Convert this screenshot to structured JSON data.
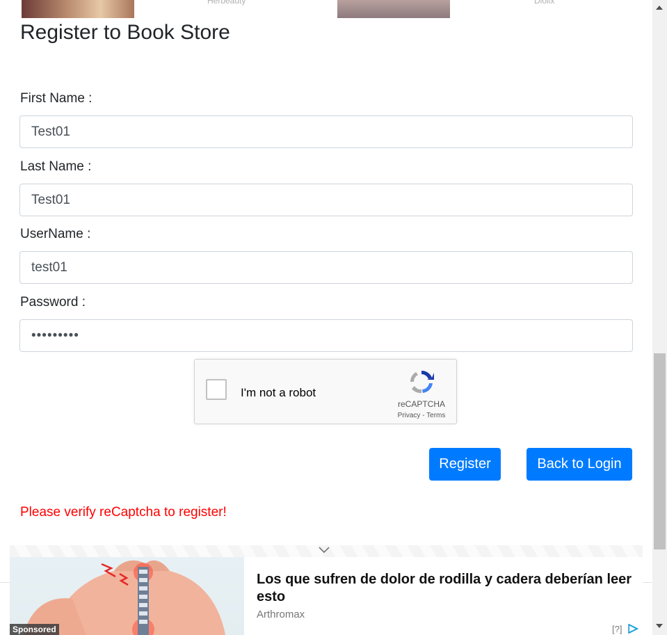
{
  "top_ads": [
    {
      "label": "Herbeauty"
    },
    {
      "label": "Dlolix"
    }
  ],
  "page": {
    "title": "Register to Book Store"
  },
  "form": {
    "first_name": {
      "label": "First Name :",
      "value": "Test01"
    },
    "last_name": {
      "label": "Last Name :",
      "value": "Test01"
    },
    "username": {
      "label": "UserName :",
      "value": "test01"
    },
    "password": {
      "label": "Password :",
      "value": "•••••••••"
    }
  },
  "recaptcha": {
    "text": "I'm not a robot",
    "brand": "reCAPTCHA",
    "links": "Privacy - Terms"
  },
  "buttons": {
    "register": "Register",
    "back_to_login": "Back to Login"
  },
  "error": "Please verify reCaptcha to register!",
  "sponsored_ad": {
    "headline": "Los que sufren de dolor de rodilla y cadera deberían leer esto",
    "source": "Arthromax",
    "badge": "Sponsored",
    "info": "[?]"
  },
  "colors": {
    "primary": "#007bff",
    "error": "#ff0000",
    "text": "#212529"
  }
}
